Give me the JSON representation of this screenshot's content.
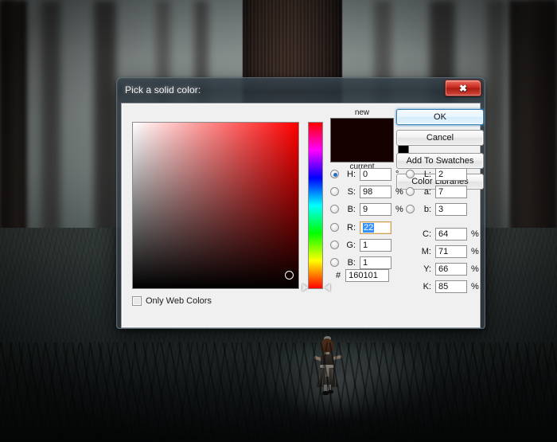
{
  "background": {
    "scene": "dark misty forest with large tree trunk and a girl in a striped dress walking on a lit path"
  },
  "dialog": {
    "title": "Pick a solid color:",
    "close_icon": "✖",
    "buttons": {
      "ok": "OK",
      "cancel": "Cancel",
      "add_to_swatches": "Add To Swatches",
      "color_libraries": "Color Libraries"
    },
    "preview": {
      "new_label": "new",
      "current_label": "current",
      "new_color": "#160101",
      "current_color": "#160101",
      "websafe_color": "#000000"
    },
    "only_web_colors": {
      "label": "Only Web Colors",
      "checked": false
    },
    "hex": {
      "hash": "#",
      "value": "160101"
    },
    "hsb": [
      {
        "key": "H",
        "label": "H:",
        "value": "0",
        "unit": "°",
        "selected": true,
        "focused": false
      },
      {
        "key": "S",
        "label": "S:",
        "value": "98",
        "unit": "%",
        "selected": false,
        "focused": false
      },
      {
        "key": "B",
        "label": "B:",
        "value": "9",
        "unit": "%",
        "selected": false,
        "focused": false
      }
    ],
    "rgb": [
      {
        "key": "R",
        "label": "R:",
        "value": "22",
        "unit": "",
        "selected": false,
        "focused": true
      },
      {
        "key": "G",
        "label": "G:",
        "value": "1",
        "unit": "",
        "selected": false,
        "focused": false
      },
      {
        "key": "B",
        "label": "B:",
        "value": "1",
        "unit": "",
        "selected": false,
        "focused": false
      }
    ],
    "lab": [
      {
        "key": "L",
        "label": "L:",
        "value": "2",
        "unit": "",
        "selected": false
      },
      {
        "key": "a",
        "label": "a:",
        "value": "7",
        "unit": "",
        "selected": false
      },
      {
        "key": "b",
        "label": "b:",
        "value": "3",
        "unit": "",
        "selected": false
      }
    ],
    "cmyk": [
      {
        "key": "C",
        "label": "C:",
        "value": "64",
        "unit": "%"
      },
      {
        "key": "M",
        "label": "M:",
        "value": "71",
        "unit": "%"
      },
      {
        "key": "Y",
        "label": "Y:",
        "value": "66",
        "unit": "%"
      },
      {
        "key": "K",
        "label": "K:",
        "value": "85",
        "unit": "%"
      }
    ],
    "field": {
      "hue_color": "#ff0000",
      "marker_x_pct": 94,
      "marker_y_pct": 92,
      "hue_position_pct": 100
    }
  }
}
